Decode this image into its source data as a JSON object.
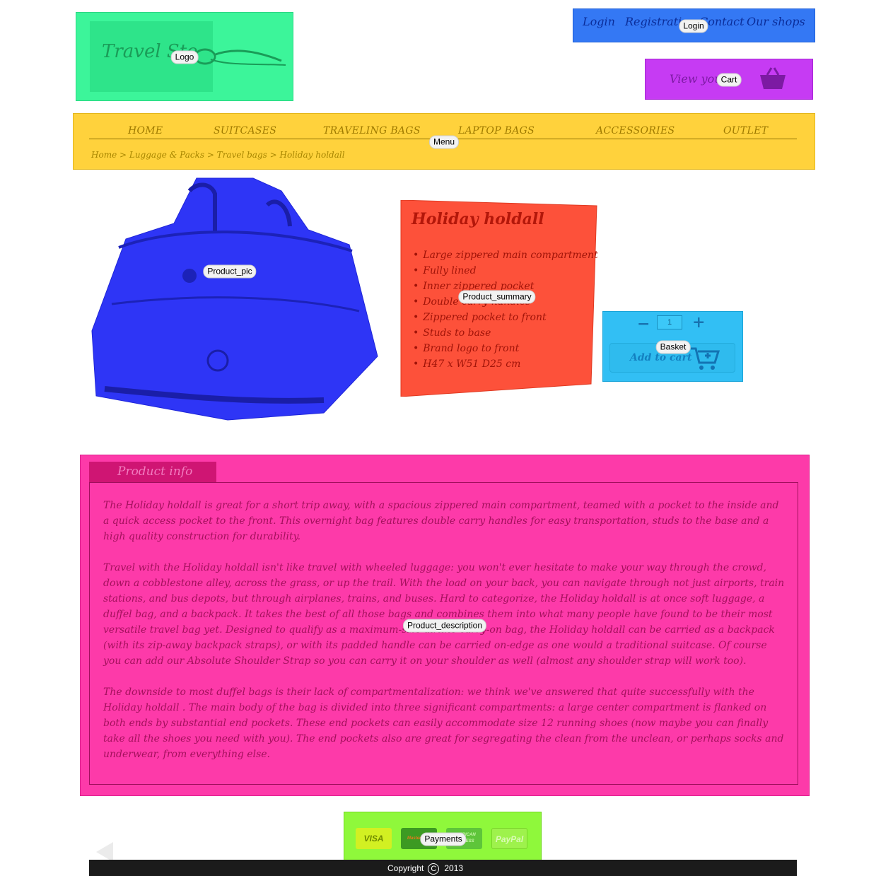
{
  "overlay_labels": {
    "logo": "Logo",
    "login": "Login",
    "cart": "Cart",
    "menu": "Menu",
    "product_pic": "Product_pic",
    "product_summary": "Product_summary",
    "basket": "Basket",
    "product_description": "Product_description",
    "payments": "Payments"
  },
  "logo": {
    "text": "Travel Sto",
    "icon": "luggage-tag-icon"
  },
  "top_links": [
    "Login",
    "Registration",
    "Contact",
    "Our shops"
  ],
  "cart": {
    "text": "View your",
    "icon": "shopping-basket-icon"
  },
  "menu": {
    "items": [
      "HOME",
      "SUITCASES",
      "TRAVELING BAGS",
      "LAPTOP BAGS",
      "ACCESSORIES",
      "OUTLET"
    ],
    "breadcrumb": "Home > Luggage & Packs > Travel bags > Holiday holdall"
  },
  "product": {
    "title": "Holiday holdall",
    "features": [
      "Large zippered main compartment",
      "Fully lined",
      "Inner zippered pocket",
      "Double carry handles",
      "Zippered pocket to front",
      "Studs to base",
      "Brand logo to front",
      "H47 x W51 D25 cm"
    ]
  },
  "basket": {
    "minus": "−",
    "plus": "+",
    "quantity": "1",
    "add_label": "Add to cart",
    "icon": "add-to-cart-icon"
  },
  "info": {
    "tab": "Product info",
    "paragraphs": [
      "The Holiday holdall is great for a short trip away, with a spacious zippered main compartment, teamed with a pocket to the inside and a quick access pocket to the front. This overnight bag features double carry handles for easy transportation, studs to the base and a high quality construction for durability.",
      "Travel with the Holiday holdall isn't like travel with wheeled luggage: you won't ever hesitate to make your way through the crowd, down a cobblestone alley, across the grass, or up the trail. With the load on your back, you can navigate through not just airports, train stations, and bus depots, but through airplanes, trains, and buses. Hard to categorize, the Holiday holdall is at once soft luggage, a duffel bag, and a backpack. It takes the best of all those bags and combines them into what many people have found to be their most versatile travel bag yet. Designed to qualify as a maximum-size airline carry-on bag, the Holiday holdall can be carried as a backpack (with its zip-away backpack straps), or with its padded handle can be carried on-edge as one would a traditional suitcase. Of course you can add our Absolute Shoulder Strap so you can carry it on your shoulder as well (almost any shoulder strap will work too).",
      "The downside to most duffel bags is their lack of compartmentalization: we think we've answered that quite successfully with the Holiday holdall . The main body of the bag is divided into three significant compartments: a large center compartment is flanked on both ends by substantial end pockets. These end pockets can easily accommodate size 12 running shoes (now maybe you can finally take all the shoes you need with you). The end pockets also are great for segregating the clean from the unclean, or perhaps socks and underwear, from everything else."
    ]
  },
  "payments": [
    {
      "label": "VISA",
      "color": "#d2f022"
    },
    {
      "label": "MasterCard",
      "color": "#3c9a22"
    },
    {
      "label": "AMERICAN EXPRESS",
      "color": "#5ec53a"
    },
    {
      "label": "PayPal",
      "color": "#9ef24c"
    }
  ],
  "footer": {
    "prefix": "Copyright",
    "symbol": "C",
    "year": "2013"
  },
  "colors": {
    "logo": "#3cf59a",
    "login": "#3478f4",
    "cart": "#c63bf3",
    "menu": "#ffd23c",
    "product_pic": "#2e35f6",
    "product_summary": "#fd513a",
    "basket": "#32bff4",
    "product_info": "#fd3aa9",
    "payments": "#8ff83b",
    "footer": "#1b1b1b"
  }
}
